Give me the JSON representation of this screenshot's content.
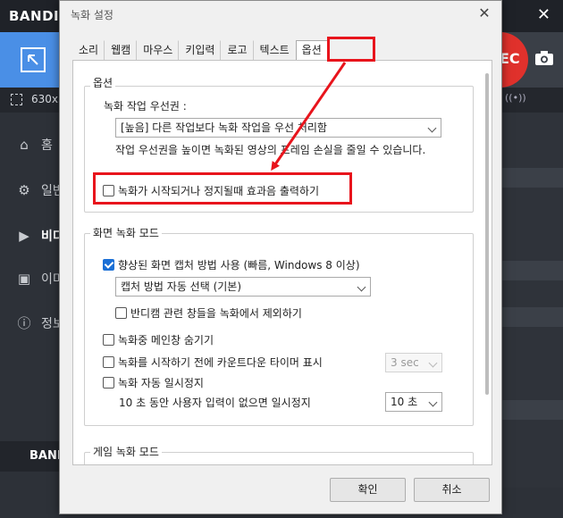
{
  "app": {
    "brand": "BANDIC",
    "close_label": "✕",
    "rec_label": "EC",
    "resolution": "630x5",
    "nav": [
      {
        "label": "홈",
        "icon": "home-icon"
      },
      {
        "label": "일반",
        "icon": "gear-icon"
      },
      {
        "label": "비디",
        "icon": "video-icon"
      },
      {
        "label": "이미",
        "icon": "image-icon"
      },
      {
        "label": "정보",
        "icon": "info-icon"
      }
    ],
    "footer_brand": "BAND"
  },
  "dialog": {
    "title": "녹화 설정",
    "close_label": "✕",
    "tabs": [
      "소리",
      "웹캠",
      "마우스",
      "키입력",
      "로고",
      "텍스트",
      "옵션"
    ],
    "active_tab": "옵션",
    "options_group": {
      "legend": "옵션",
      "priority_label": "녹화 작업 우선권 :",
      "priority_value": "[높음] 다른 작업보다 녹화 작업을 우선 처리함",
      "priority_help": "작업 우선권을 높이면 녹화된 영상의 프레임 손실을 줄일 수 있습니다.",
      "sound_effect": {
        "label": "녹화가 시작되거나 정지될때 효과음 출력하기",
        "checked": false
      }
    },
    "screen_group": {
      "legend": "화면 녹화 모드",
      "enhanced_capture": {
        "label": "향상된 화면 캡처 방법 사용 (빠름, Windows 8 이상)",
        "checked": true
      },
      "capture_method": "캡처 방법 자동 선택 (기본)",
      "exclude_bandicam": {
        "label": "반디캠 관련 창들을 녹화에서 제외하기",
        "checked": false
      },
      "hide_main": {
        "label": "녹화중 메인창 숨기기",
        "checked": false
      },
      "countdown": {
        "label": "녹화를 시작하기 전에 카운트다운 타이머 표시",
        "checked": false
      },
      "countdown_value": "3 sec",
      "auto_pause": {
        "label": "녹화 자동 일시정지",
        "checked": false
      },
      "auto_pause_desc": "10 초 동안 사용자 입력이 없으면 일시정지",
      "auto_pause_value": "10 초"
    },
    "game_group": {
      "legend": "게임 녹화 모드"
    },
    "ok_label": "확인",
    "cancel_label": "취소"
  },
  "colors": {
    "annotation": "#e8141c",
    "accent": "#1a6fd6",
    "rec": "#e0312c",
    "mode_active": "#4a8fe6"
  }
}
